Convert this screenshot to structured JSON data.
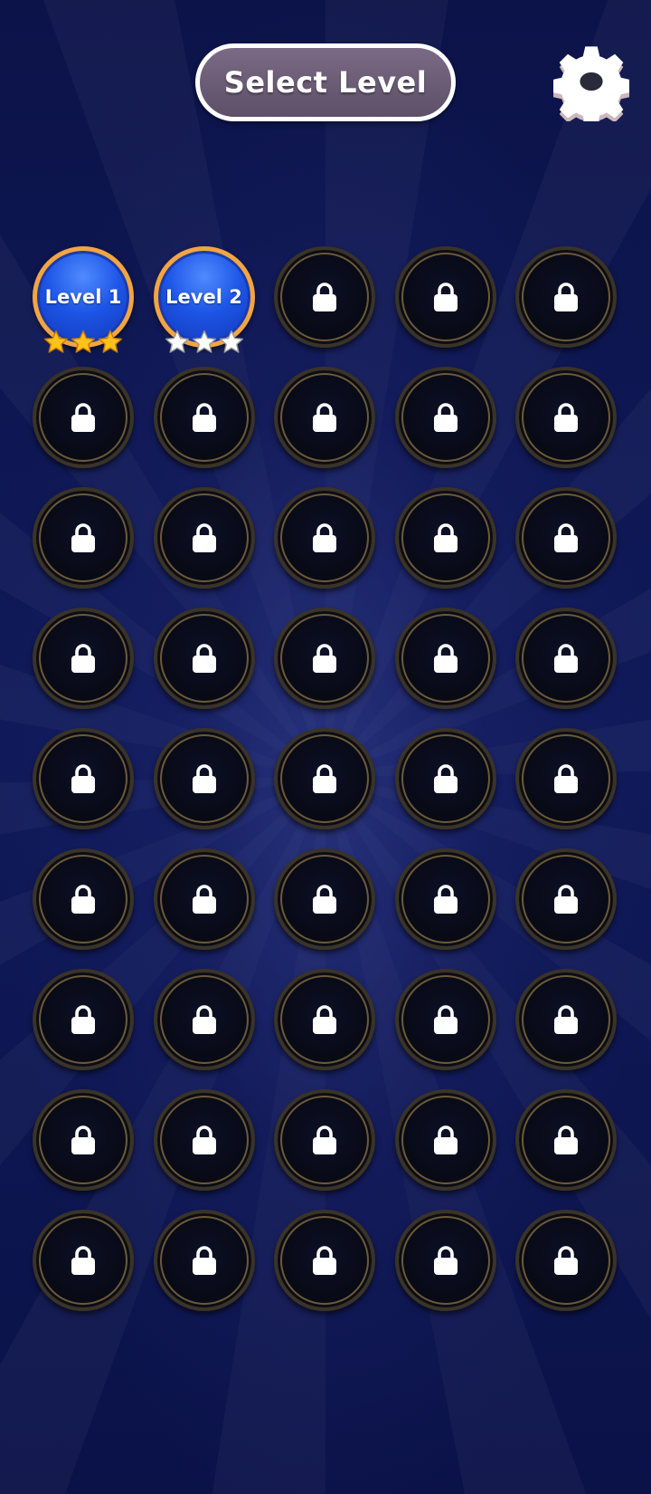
{
  "header": {
    "title": "Select Level",
    "settings_icon": "gear-icon"
  },
  "colors": {
    "background": "#0d1450",
    "pill_fill": "#6b5d78",
    "level_blue": "#1d55e6",
    "level_ring": "#f3a540",
    "star_gold": "#ffc21a",
    "star_empty": "#ffffff"
  },
  "levels": [
    {
      "label": "Level 1",
      "locked": false,
      "stars_earned": 3,
      "stars_total": 3
    },
    {
      "label": "Level 2",
      "locked": false,
      "stars_earned": 0,
      "stars_total": 3
    },
    {
      "locked": true
    },
    {
      "locked": true
    },
    {
      "locked": true
    },
    {
      "locked": true
    },
    {
      "locked": true
    },
    {
      "locked": true
    },
    {
      "locked": true
    },
    {
      "locked": true
    },
    {
      "locked": true
    },
    {
      "locked": true
    },
    {
      "locked": true
    },
    {
      "locked": true
    },
    {
      "locked": true
    },
    {
      "locked": true
    },
    {
      "locked": true
    },
    {
      "locked": true
    },
    {
      "locked": true
    },
    {
      "locked": true
    },
    {
      "locked": true
    },
    {
      "locked": true
    },
    {
      "locked": true
    },
    {
      "locked": true
    },
    {
      "locked": true
    },
    {
      "locked": true
    },
    {
      "locked": true
    },
    {
      "locked": true
    },
    {
      "locked": true
    },
    {
      "locked": true
    },
    {
      "locked": true
    },
    {
      "locked": true
    },
    {
      "locked": true
    },
    {
      "locked": true
    },
    {
      "locked": true
    },
    {
      "locked": true
    },
    {
      "locked": true
    },
    {
      "locked": true
    },
    {
      "locked": true
    },
    {
      "locked": true
    },
    {
      "locked": true
    },
    {
      "locked": true
    },
    {
      "locked": true
    },
    {
      "locked": true
    },
    {
      "locked": true
    }
  ],
  "locked_icon": "lock-icon"
}
